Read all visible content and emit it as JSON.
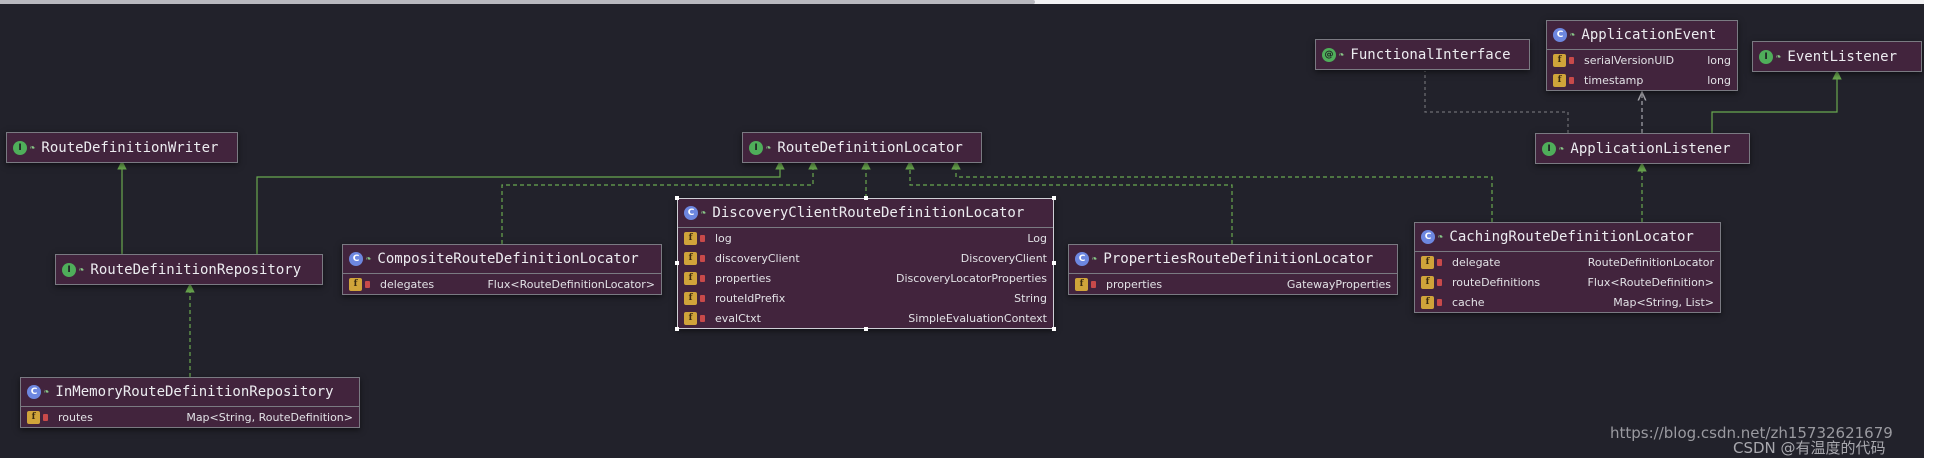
{
  "diagram": {
    "nodes": [
      {
        "id": "functional_interface",
        "kind": "annotation",
        "name": "FunctionalInterface",
        "fields": []
      },
      {
        "id": "application_event",
        "kind": "class",
        "name": "ApplicationEvent",
        "fields": [
          {
            "name": "serialVersionUID",
            "type": "long"
          },
          {
            "name": "timestamp",
            "type": "long"
          }
        ]
      },
      {
        "id": "event_listener",
        "kind": "interface",
        "name": "EventListener",
        "fields": []
      },
      {
        "id": "route_definition_writer",
        "kind": "interface",
        "name": "RouteDefinitionWriter",
        "fields": []
      },
      {
        "id": "route_definition_locator",
        "kind": "interface",
        "name": "RouteDefinitionLocator",
        "fields": []
      },
      {
        "id": "application_listener",
        "kind": "interface",
        "name": "ApplicationListener",
        "fields": []
      },
      {
        "id": "route_definition_repository",
        "kind": "interface",
        "name": "RouteDefinitionRepository",
        "fields": []
      },
      {
        "id": "composite_locator",
        "kind": "class",
        "name": "CompositeRouteDefinitionLocator",
        "fields": [
          {
            "name": "delegates",
            "type": "Flux<RouteDefinitionLocator>"
          }
        ]
      },
      {
        "id": "discovery_locator",
        "kind": "class",
        "name": "DiscoveryClientRouteDefinitionLocator",
        "fields": [
          {
            "name": "log",
            "type": "Log"
          },
          {
            "name": "discoveryClient",
            "type": "DiscoveryClient"
          },
          {
            "name": "properties",
            "type": "DiscoveryLocatorProperties"
          },
          {
            "name": "routeIdPrefix",
            "type": "String"
          },
          {
            "name": "evalCtxt",
            "type": "SimpleEvaluationContext"
          }
        ]
      },
      {
        "id": "properties_locator",
        "kind": "class",
        "name": "PropertiesRouteDefinitionLocator",
        "fields": [
          {
            "name": "properties",
            "type": "GatewayProperties"
          }
        ]
      },
      {
        "id": "caching_locator",
        "kind": "class",
        "name": "CachingRouteDefinitionLocator",
        "fields": [
          {
            "name": "delegate",
            "type": "RouteDefinitionLocator"
          },
          {
            "name": "routeDefinitions",
            "type": "Flux<RouteDefinition>"
          },
          {
            "name": "cache",
            "type": "Map<String, List>"
          }
        ]
      },
      {
        "id": "in_memory_repository",
        "kind": "class",
        "name": "InMemoryRouteDefinitionRepository",
        "fields": [
          {
            "name": "routes",
            "type": "Map<String, RouteDefinition>"
          }
        ]
      }
    ],
    "relations": [
      {
        "from": "route_definition_repository",
        "to": "route_definition_writer",
        "type": "extends"
      },
      {
        "from": "route_definition_repository",
        "to": "route_definition_locator",
        "type": "extends"
      },
      {
        "from": "in_memory_repository",
        "to": "route_definition_repository",
        "type": "implements"
      },
      {
        "from": "composite_locator",
        "to": "route_definition_locator",
        "type": "implements"
      },
      {
        "from": "discovery_locator",
        "to": "route_definition_locator",
        "type": "implements"
      },
      {
        "from": "properties_locator",
        "to": "route_definition_locator",
        "type": "implements"
      },
      {
        "from": "caching_locator",
        "to": "route_definition_locator",
        "type": "implements"
      },
      {
        "from": "caching_locator",
        "to": "application_listener",
        "type": "implements"
      },
      {
        "from": "application_listener",
        "to": "event_listener",
        "type": "extends"
      },
      {
        "from": "application_listener",
        "to": "application_event",
        "type": "uses"
      },
      {
        "from": "application_listener",
        "to": "functional_interface",
        "type": "annotated"
      }
    ]
  },
  "icons": {
    "interface": "interface-icon",
    "class": "class-icon",
    "annotation": "annotation-icon",
    "field": "field-icon",
    "private": "lock-icon"
  },
  "colors": {
    "background": "#22222b",
    "node_fill": "#42243d",
    "edge": "#6aa84f"
  },
  "watermark": {
    "url": "https://blog.csdn.net/zh15732621679",
    "credit": "CSDN @有温度的代码"
  }
}
